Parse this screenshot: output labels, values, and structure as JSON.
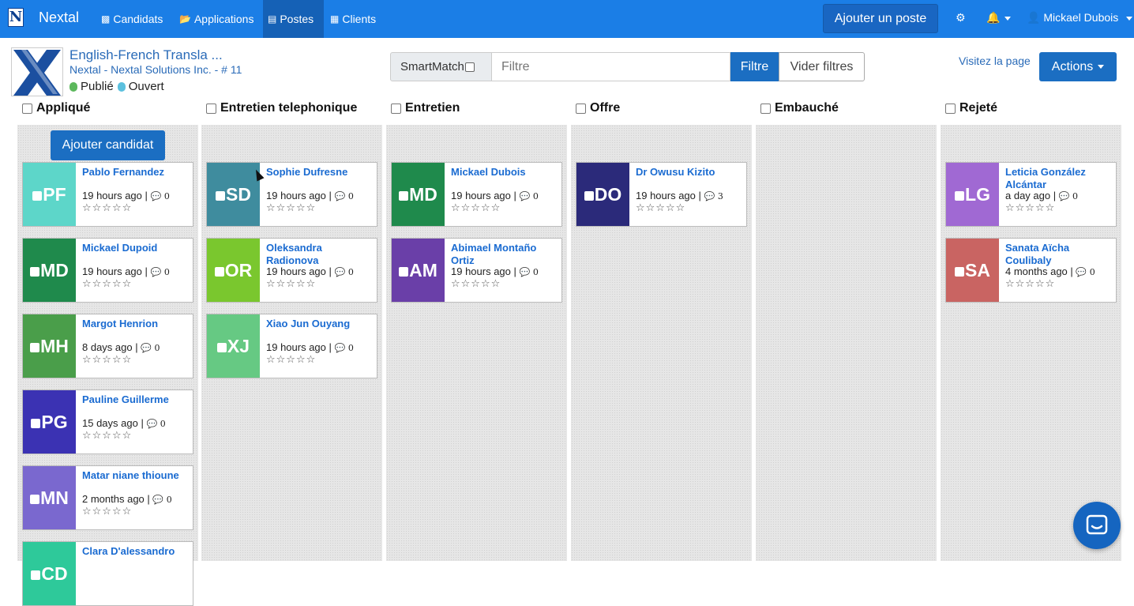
{
  "nav": {
    "brand_letter": "N",
    "brand": "Nextal",
    "items": [
      {
        "label": "Candidats",
        "icon": "candidates-icon",
        "active": false
      },
      {
        "label": "Applications",
        "icon": "folder-icon",
        "active": false
      },
      {
        "label": "Postes",
        "icon": "postes-icon",
        "active": true
      },
      {
        "label": "Clients",
        "icon": "building-icon",
        "active": false
      }
    ],
    "add_post": "Ajouter un poste",
    "user": "Mickael Dubois"
  },
  "job": {
    "title": "English-French Transla ...",
    "company": "Nextal - Nextal Solutions Inc. - # 11",
    "status_published": "Publié",
    "status_open": "Ouvert",
    "published_color": "#5cb85c",
    "open_color": "#5bc0de"
  },
  "filters": {
    "smartmatch": "SmartMatch",
    "placeholder": "Filtre",
    "filter_btn": "Filtre",
    "clear_btn": "Vider filtres",
    "visit": "Visitez la page",
    "actions": "Actions"
  },
  "add_candidate": "Ajouter candidat",
  "columns": [
    {
      "label": "Appliqué",
      "cards": [
        {
          "initials": "PF",
          "name": "Pablo Fernandez",
          "time": "19 hours ago",
          "comments": "0",
          "color": "#5dd6c9"
        },
        {
          "initials": "MD",
          "name": "Mickael Dupoid",
          "time": "19 hours ago",
          "comments": "0",
          "color": "#1f8a4c"
        },
        {
          "initials": "MH",
          "name": "Margot Henrion",
          "time": "8 days ago",
          "comments": "0",
          "color": "#4a9e4a"
        },
        {
          "initials": "PG",
          "name": "Pauline Guillerme",
          "time": "15 days ago",
          "comments": "0",
          "color": "#3b32b3"
        },
        {
          "initials": "MN",
          "name": "Matar niane thioune",
          "time": "2 months ago",
          "comments": "0",
          "color": "#7a68cf"
        },
        {
          "initials": "CD",
          "name": "Clara D'alessandro",
          "time": "",
          "comments": "",
          "color": "#2ec99a"
        }
      ]
    },
    {
      "label": "Entretien telephonique",
      "cards": [
        {
          "initials": "SD",
          "name": "Sophie Dufresne",
          "time": "19 hours ago",
          "comments": "0",
          "color": "#3f8c9e"
        },
        {
          "initials": "OR",
          "name": "Oleksandra Radionova",
          "time": "19 hours ago",
          "comments": "0",
          "color": "#7ac72e"
        },
        {
          "initials": "XJ",
          "name": "Xiao Jun Ouyang",
          "time": "19 hours ago",
          "comments": "0",
          "color": "#66c983"
        }
      ]
    },
    {
      "label": "Entretien",
      "cards": [
        {
          "initials": "MD",
          "name": "Mickael Dubois",
          "time": "19 hours ago",
          "comments": "0",
          "color": "#1f8a4c"
        },
        {
          "initials": "AM",
          "name": "Abimael Montaño Ortiz",
          "time": "19 hours ago",
          "comments": "0",
          "color": "#6a3fa8"
        }
      ]
    },
    {
      "label": "Offre",
      "cards": [
        {
          "initials": "DO",
          "name": "Dr Owusu Kizito",
          "time": "19 hours ago",
          "comments": "3",
          "color": "#2b2a7a"
        }
      ]
    },
    {
      "label": "Embauché",
      "cards": []
    },
    {
      "label": "Rejeté",
      "cards": [
        {
          "initials": "LG",
          "name": "Leticia González Alcántar",
          "time": "a day ago",
          "comments": "0",
          "color": "#a069d3"
        },
        {
          "initials": "SA",
          "name": "Sanata Aïcha Coulibaly",
          "time": "4 months ago",
          "comments": "0",
          "color": "#c96462"
        }
      ]
    }
  ]
}
